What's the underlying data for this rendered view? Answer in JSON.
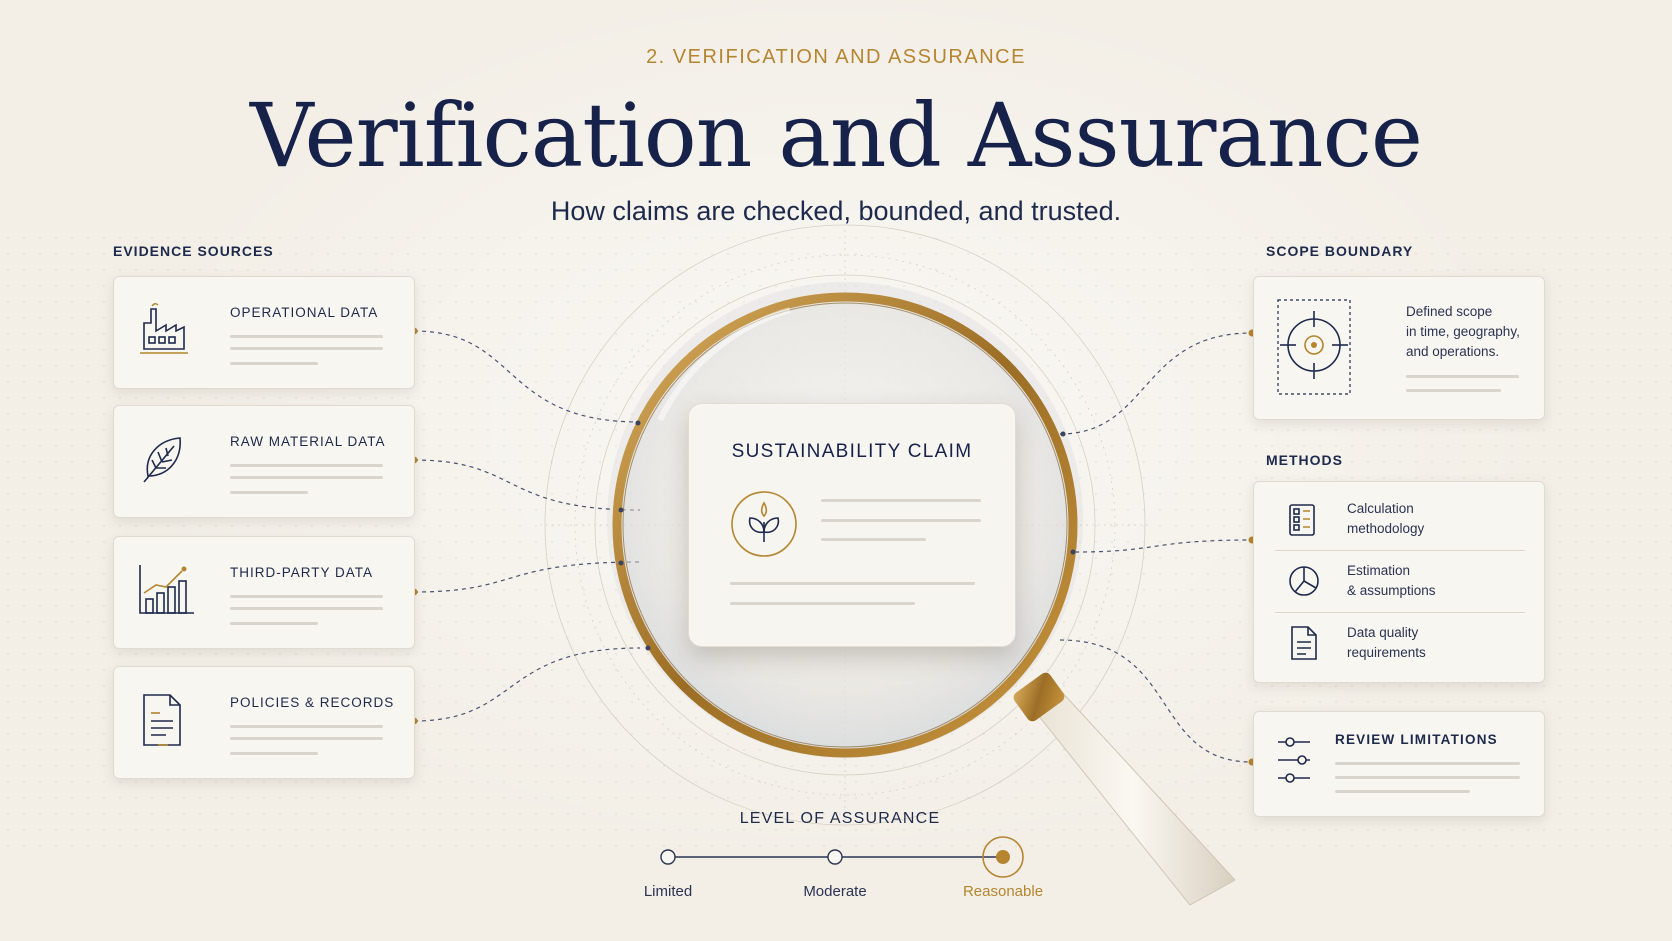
{
  "header": {
    "eyebrow": "2. VERIFICATION AND ASSURANCE",
    "title": "Verification and Assurance",
    "subtitle": "How claims are checked, bounded, and trusted."
  },
  "evidence": {
    "label": "EVIDENCE SOURCES",
    "items": [
      {
        "title": "OPERATIONAL DATA",
        "icon": "factory-icon"
      },
      {
        "title": "RAW MATERIAL DATA",
        "icon": "leaf-icon"
      },
      {
        "title": "THIRD-PARTY DATA",
        "icon": "bar-chart-icon"
      },
      {
        "title": "POLICIES & RECORDS",
        "icon": "document-icon"
      }
    ]
  },
  "claim": {
    "title": "SUSTAINABILITY CLAIM",
    "icon": "sprout-icon"
  },
  "scope": {
    "label": "SCOPE BOUNDARY",
    "text_lines": [
      "Defined scope",
      "in time, geography,",
      "and operations."
    ],
    "icon": "target-icon"
  },
  "methods": {
    "label": "METHODS",
    "items": [
      {
        "lines": [
          "Calculation",
          "methodology"
        ],
        "icon": "calculator-icon"
      },
      {
        "lines": [
          "Estimation",
          "& assumptions"
        ],
        "icon": "pie-chart-icon"
      },
      {
        "lines": [
          "Data quality",
          "requirements"
        ],
        "icon": "document-icon"
      }
    ]
  },
  "limitations": {
    "title": "REVIEW LIMITATIONS",
    "icon": "sliders-icon"
  },
  "assurance": {
    "label": "LEVEL OF ASSURANCE",
    "levels": [
      "Limited",
      "Moderate",
      "Reasonable"
    ],
    "selected": "Reasonable"
  },
  "colors": {
    "navy": "#16224a",
    "gold": "#b5852f",
    "background": "#f3efe7"
  }
}
